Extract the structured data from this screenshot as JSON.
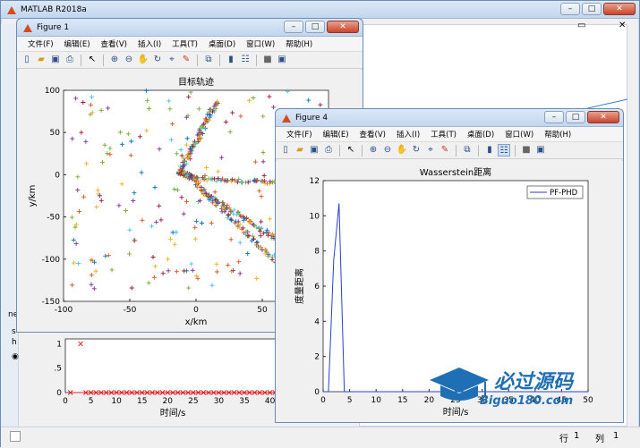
{
  "main_window": {
    "title": "MATLAB R2018a",
    "status_row_label": "行",
    "status_row_value": "1",
    "status_col_label": "列",
    "status_col_value": "1"
  },
  "menu_labels": [
    "文件(F)",
    "编辑(E)",
    "查看(V)",
    "插入(I)",
    "工具(T)",
    "桌面(D)",
    "窗口(W)",
    "帮助(H)"
  ],
  "figure1": {
    "title": "Figure 1",
    "plot_title": "目标轨迹",
    "xlabel": "x/km",
    "ylabel": "y/km",
    "xticks": [
      "-100",
      "-50",
      "0",
      "50",
      "100"
    ],
    "yticks": [
      "100",
      "50",
      "0",
      "-50",
      "-100",
      "-150"
    ]
  },
  "figure4": {
    "title": "Figure 4",
    "plot_title": "Wasserstein距离",
    "xlabel": "时间/s",
    "ylabel": "度量距离",
    "legend": "PF-PHD",
    "xticks": [
      "0",
      "5",
      "10",
      "15",
      "20",
      "25",
      "30",
      "35",
      "40",
      "45",
      "50"
    ],
    "yticks": [
      "0",
      "2",
      "4",
      "6",
      "8",
      "10",
      "12"
    ]
  },
  "background_plot": {
    "xlabel": "时间/s",
    "xticks": [
      "0",
      "5",
      "10",
      "15",
      "20",
      "25",
      "30",
      "35",
      "40"
    ],
    "yticks": [
      "1",
      "0.5",
      "0"
    ]
  },
  "watermark": {
    "brand": "必过源码",
    "url": "Biguo180.com"
  },
  "chart_data": [
    {
      "type": "scatter",
      "title": "目标轨迹",
      "xlabel": "x/km",
      "ylabel": "y/km",
      "xlim": [
        -100,
        100
      ],
      "ylim": [
        -150,
        100
      ],
      "tracks": [
        {
          "from": [
            15,
            85
          ],
          "to": [
            -12,
            3
          ]
        },
        {
          "from": [
            -12,
            3
          ],
          "to": [
            0,
            -5
          ]
        },
        {
          "from": [
            0,
            -5
          ],
          "to": [
            100,
            -12
          ]
        },
        {
          "from": [
            0,
            -10
          ],
          "to": [
            65,
            -110
          ]
        },
        {
          "from": [
            5,
            -20
          ],
          "to": [
            75,
            -90
          ]
        }
      ]
    },
    {
      "type": "line",
      "title": "Wasserstein距离",
      "xlabel": "时间/s",
      "ylabel": "度量距离",
      "xlim": [
        0,
        50
      ],
      "ylim": [
        0,
        12
      ],
      "series": [
        {
          "name": "PF-PHD",
          "x": [
            0,
            1,
            2,
            3,
            4,
            5,
            10,
            15,
            20,
            25,
            30,
            35,
            40,
            45,
            50
          ],
          "y": [
            0,
            0,
            7.5,
            10.7,
            0,
            0,
            0,
            0,
            0,
            0,
            0,
            0,
            0,
            0,
            0
          ]
        }
      ]
    },
    {
      "type": "scatter",
      "xlabel": "时间/s",
      "xlim": [
        0,
        42
      ],
      "ylim": [
        0,
        1.1
      ],
      "series": [
        {
          "x": [
            1,
            3,
            4,
            5,
            6,
            7,
            8,
            9,
            10,
            11,
            12,
            13,
            14,
            15,
            16,
            17,
            18,
            19,
            20,
            21,
            22,
            23,
            24,
            25,
            26,
            27,
            28,
            29,
            30,
            31,
            32,
            33,
            34,
            35,
            36,
            37,
            38,
            39,
            40,
            41
          ],
          "y": [
            0,
            1,
            0,
            0,
            0,
            0,
            0,
            0,
            0,
            0,
            0,
            0,
            0,
            0,
            0,
            0,
            0,
            0,
            0,
            0,
            0,
            0,
            0,
            0,
            0,
            0,
            0,
            0,
            0,
            0,
            0,
            0,
            0,
            0,
            0,
            0,
            0,
            0,
            0,
            0
          ]
        }
      ]
    }
  ]
}
